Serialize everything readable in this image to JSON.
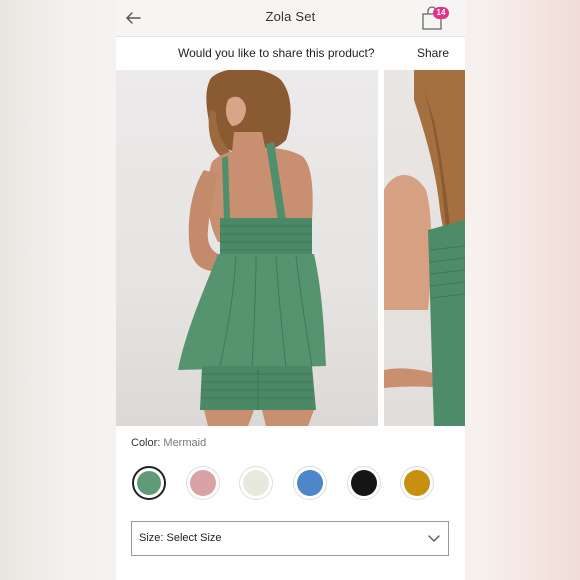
{
  "header": {
    "title": "Zola Set",
    "cart_count": "14"
  },
  "share_bar": {
    "question": "Would you like to share this product?",
    "action_label": "Share"
  },
  "product": {
    "color_label": "Color:",
    "color_value": "Mermaid",
    "swatches": [
      {
        "name": "Mermaid",
        "color": "#5f9b76",
        "selected": true
      },
      {
        "name": "Pink",
        "color": "#d9a3a5",
        "selected": false
      },
      {
        "name": "Ivory",
        "color": "#e9e8e0",
        "selected": false
      },
      {
        "name": "Blue",
        "color": "#4f86c9",
        "selected": false
      },
      {
        "name": "Black",
        "color": "#151515",
        "selected": false
      },
      {
        "name": "Mustard",
        "color": "#c98f10",
        "selected": false
      }
    ],
    "size_label": "Size: Select Size"
  },
  "colors": {
    "badge": "#e2358a",
    "garment": "#4f8f6c"
  },
  "icons": {
    "back": "back-arrow-icon",
    "bag": "shopping-bag-icon",
    "dropdown": "chevron-down-icon"
  }
}
